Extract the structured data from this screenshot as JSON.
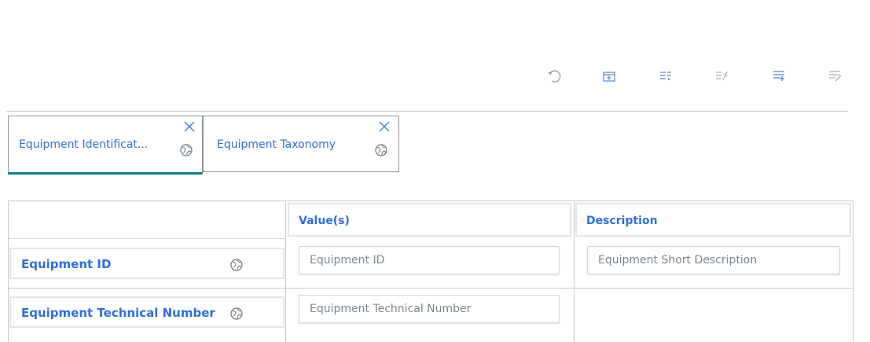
{
  "toolbar": {
    "buttons": [
      {
        "name": "undo-icon"
      },
      {
        "name": "add-row-icon"
      },
      {
        "name": "expand-rows-icon"
      },
      {
        "name": "collapse-rows-icon"
      },
      {
        "name": "insert-row-icon"
      },
      {
        "name": "remove-row-icon"
      }
    ]
  },
  "tabs": [
    {
      "label": "Equipment Identificat...",
      "active": true
    },
    {
      "label": "Equipment Taxonomy",
      "active": false
    }
  ],
  "grid": {
    "headers": [
      "",
      "Value(s)",
      "Description"
    ],
    "rows": [
      {
        "name": "Equipment ID",
        "value_placeholder": "Equipment ID",
        "description_placeholder": "Equipment Short Description"
      },
      {
        "name": "Equipment Technical Number",
        "value_placeholder": "Equipment Technical Number"
      }
    ]
  },
  "colors": {
    "link_blue": "#2e6fd8",
    "active_tab_underline": "#0e7f8a",
    "icon_active": "#5a8fd6",
    "icon_muted": "#a9b4c0"
  }
}
